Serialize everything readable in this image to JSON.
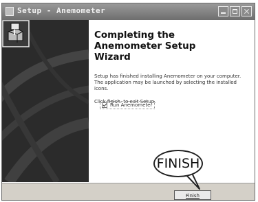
{
  "window": {
    "title": "Setup - Anemometer"
  },
  "wizard": {
    "heading": "Completing the Anemometer Setup Wizard",
    "description": "Setup has finished installing Anemometer on your computer. The application may be launched by selecting the installed icons.",
    "click_instruction": "Click finish. to exit Setup.",
    "run_checkbox": {
      "label": "Run Anemometer",
      "checked": true
    }
  },
  "footer": {
    "finish_button_label": "Finish"
  },
  "annotation": {
    "callout_text": "FINISH"
  },
  "icons": {
    "title": "app-icon",
    "panel_logo": "installer-box-icon"
  }
}
